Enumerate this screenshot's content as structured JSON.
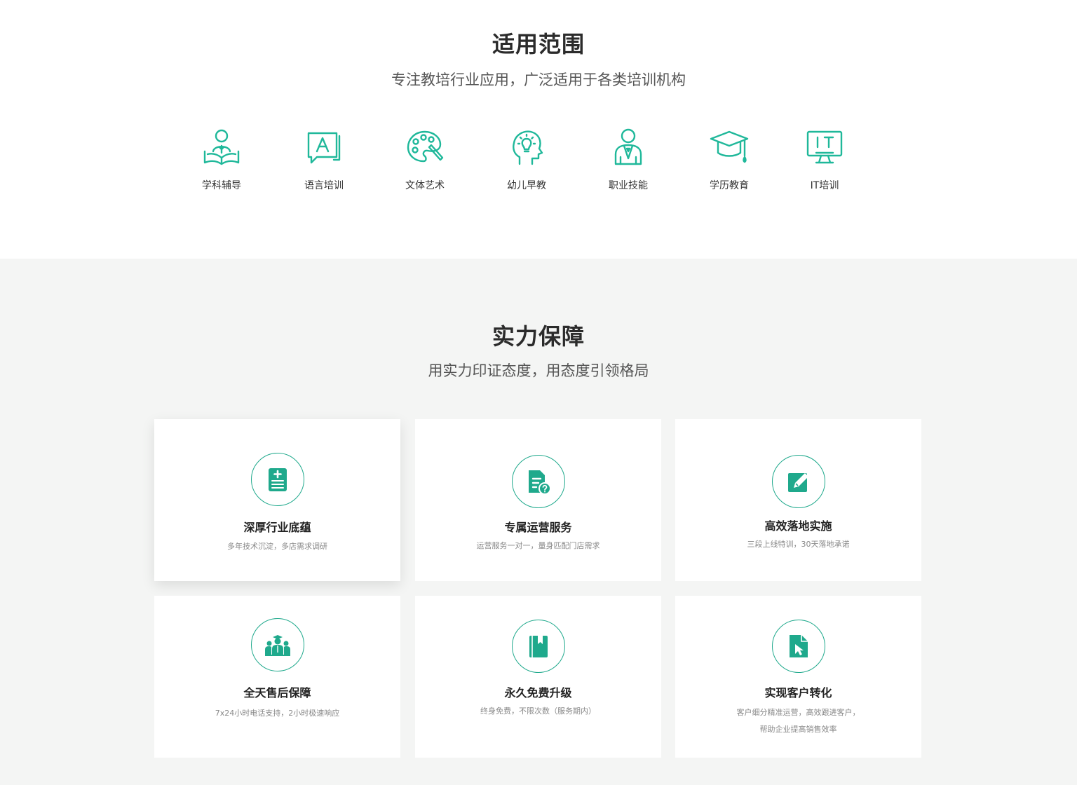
{
  "scope": {
    "title": "适用范围",
    "subtitle": "专注教培行业应用，广泛适用于各类培训机构",
    "accent": "#1fb89a",
    "items": [
      {
        "label": "学科辅导",
        "icon": "teacher-book-icon"
      },
      {
        "label": "语言培训",
        "icon": "letter-a-chat-icon"
      },
      {
        "label": "文体艺术",
        "icon": "palette-icon"
      },
      {
        "label": "幼儿早教",
        "icon": "head-lightbulb-icon"
      },
      {
        "label": "职业技能",
        "icon": "businessman-icon"
      },
      {
        "label": "学历教育",
        "icon": "graduation-cap-icon"
      },
      {
        "label": "IT培训",
        "icon": "it-monitor-icon"
      }
    ]
  },
  "power": {
    "title": "实力保障",
    "subtitle": "用实力印证态度，用态度引领格局",
    "accent": "#1fa98c",
    "cards": [
      {
        "title": "深厚行业底蕴",
        "desc": "多年技术沉淀，多店需求调研",
        "icon": "medical-clipboard-icon"
      },
      {
        "title": "专属运营服务",
        "desc": "运营服务一对一，量身匹配门店需求",
        "icon": "document-question-icon"
      },
      {
        "title": "高效落地实施",
        "desc": "三段上线特训，30天落地承诺",
        "icon": "edit-pencil-icon"
      },
      {
        "title": "全天售后保障",
        "desc": "7x24小时电话支持，2小时极速响应",
        "icon": "team-icon"
      },
      {
        "title": "永久免费升级",
        "desc": "终身免费，不限次数（服务期内）",
        "icon": "bookmark-book-icon"
      },
      {
        "title": "实现客户转化",
        "desc": "客户细分精准运营，高效跟进客户，",
        "desc2": "帮助企业提高销售效率",
        "icon": "file-cursor-icon"
      }
    ]
  }
}
